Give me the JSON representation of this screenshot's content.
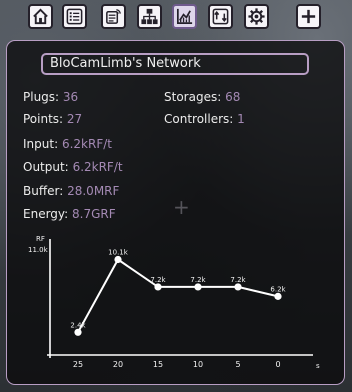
{
  "toolbar": {
    "buttons": [
      {
        "name": "home-icon",
        "active": false
      },
      {
        "name": "list-icon",
        "active": false
      },
      {
        "name": "device-icon",
        "active": false
      },
      {
        "name": "hierarchy-icon",
        "active": false
      },
      {
        "name": "stats-chart-icon",
        "active": true
      },
      {
        "name": "transfer-icon",
        "active": false
      },
      {
        "name": "gear-icon",
        "active": false
      }
    ],
    "add_button": {
      "name": "plus-icon"
    }
  },
  "network": {
    "name": "BloCamLimb's Network"
  },
  "stats": {
    "plugs": {
      "label": "Plugs:",
      "value": "36"
    },
    "points": {
      "label": "Points:",
      "value": "27"
    },
    "input": {
      "label": "Input:",
      "value": "6.2kRF/t"
    },
    "output": {
      "label": "Output:",
      "value": "6.2kRF/t"
    },
    "buffer": {
      "label": "Buffer:",
      "value": "28.0MRF"
    },
    "energy": {
      "label": "Energy:",
      "value": "8.7GRF"
    },
    "storages": {
      "label": "Storages:",
      "value": "68"
    },
    "controllers": {
      "label": "Controllers:",
      "value": "1"
    }
  },
  "chart_data": {
    "type": "line",
    "ylabel": "RF",
    "ymax_label": "11.0k",
    "xlabel": "s",
    "x": [
      25,
      20,
      15,
      10,
      5,
      0
    ],
    "values": [
      2.4,
      10.1,
      7.2,
      7.2,
      7.2,
      6.2
    ],
    "point_labels": [
      "2.4k",
      "10.1k",
      "7.2k",
      "7.2k",
      "7.2k",
      "6.2k"
    ],
    "ylim": [
      0,
      11.0
    ],
    "colors": {
      "line": "#ffffff",
      "axis": "#ffffff"
    }
  }
}
